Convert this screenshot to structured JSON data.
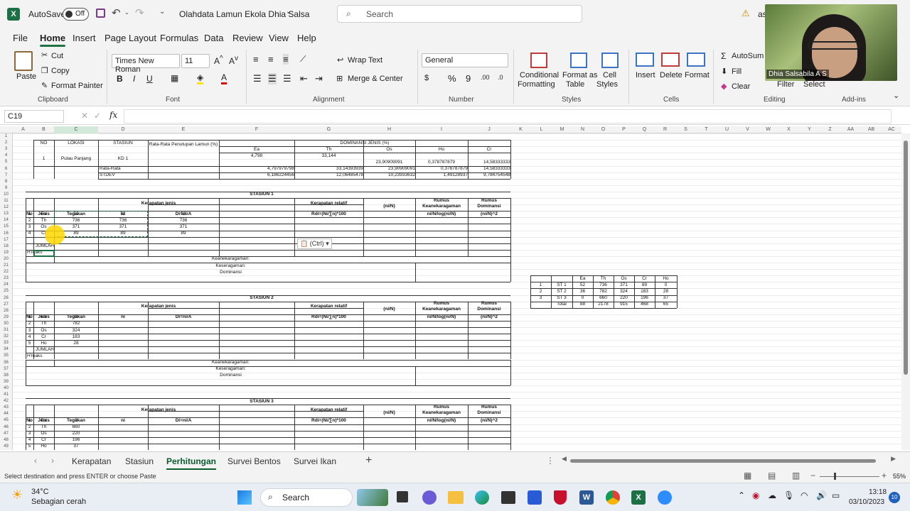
{
  "app": {
    "autosave": "AutoSave",
    "autosave_state": "Off",
    "title": "Olahdata Lamun Ekola Dhia Salsa",
    "search": "Search",
    "user_short": "as"
  },
  "menu": [
    "File",
    "Home",
    "Insert",
    "Page Layout",
    "Formulas",
    "Data",
    "Review",
    "View",
    "Help"
  ],
  "ribbon": {
    "paste": "Paste",
    "cut": "Cut",
    "copy": "Copy",
    "format_painter": "Format Painter",
    "clipboard": "Clipboard",
    "font_name": "Times New Roman",
    "font_size": "11",
    "font": "Font",
    "wrap_text": "Wrap Text",
    "merge_center": "Merge & Center",
    "alignment": "Alignment",
    "number_format": "General",
    "number": "Number",
    "cond_fmt_1": "Conditional",
    "cond_fmt_2": "Formatting",
    "fmt_table_1": "Format as",
    "fmt_table_2": "Table",
    "cell_styles_1": "Cell",
    "cell_styles_2": "Styles",
    "styles": "Styles",
    "insert": "Insert",
    "delete": "Delete",
    "format": "Format",
    "cells": "Cells",
    "autosum": "AutoSum",
    "fill": "Fill",
    "clear": "Clear",
    "filter": "Filter",
    "select": "Select",
    "editing": "Editing",
    "addins": "Add-ins",
    "bold": "B",
    "italic": "I",
    "underline": "U"
  },
  "video": {
    "name": "Dhia Salsabila A S"
  },
  "formula": {
    "namebox": "C19",
    "fx": "fx",
    "value": ""
  },
  "columns": [
    "A",
    "B",
    "C",
    "D",
    "E",
    "F",
    "G",
    "H",
    "I",
    "J",
    "K",
    "L",
    "M",
    "N",
    "O",
    "P",
    "Q",
    "R",
    "S",
    "T",
    "U",
    "V",
    "W",
    "X",
    "Y",
    "Z",
    "AA",
    "AB",
    "AC"
  ],
  "rows": [
    "1",
    "2",
    "3",
    "4",
    "5",
    "6",
    "7",
    "8",
    "9",
    "10",
    "11",
    "12",
    "13",
    "14",
    "15",
    "16",
    "17",
    "18",
    "19",
    "20",
    "21",
    "22",
    "23",
    "24",
    "25",
    "26",
    "27",
    "28",
    "29",
    "30",
    "31",
    "32",
    "33",
    "34",
    "35",
    "36",
    "37",
    "38",
    "39",
    "40",
    "41",
    "42",
    "43",
    "44",
    "45",
    "46",
    "47",
    "48",
    "49"
  ],
  "sheet": {
    "top": {
      "no": "NO",
      "lokasi": "LOKASI",
      "stasiun": "STASIUN",
      "rata": "Rata-Rata Penutupan Lamun (%)",
      "dominansi": "DOMINANSI JENIS (%)",
      "sp": [
        "Ea",
        "Th",
        "Os",
        "Ho",
        "Cr"
      ],
      "row_no": "1",
      "row_lokasi": "Pulau Panjang",
      "row_stasiun": "KD 1",
      "vals": [
        "4,798",
        "33,144",
        "23,90909091",
        "0,378787879",
        "14,58333333"
      ],
      "rata_label": "Rata-Rata",
      "rata_vals": [
        "4,797979798",
        "33,14393939",
        "23,90909091",
        "0,378787879",
        "14,58333333"
      ],
      "stdev_label": "STDEV",
      "stdev_vals": [
        "6,186224456",
        "12,06485478",
        "10,23933632",
        "1,49128937",
        "9,784754548"
      ]
    },
    "hdr": {
      "kerapatan_jenis": "Kerapatan jenis",
      "kerapatan_relatif": "Kerapatan relatif",
      "nin": "(ni/N)",
      "rumus_k1": "Rumus",
      "rumus_k2": "Keanekaragaman",
      "rumus_d1": "Rumus",
      "rumus_d2": "Dominansi",
      "no": "No",
      "jenis": "Jenis",
      "tegakan": "Tegakan",
      "ni": "ni",
      "di": "Di=ni/A",
      "rdi": "Rdi=(Ni/∑n)*100",
      "nilog": "ni/N/log(ni/N)",
      "nin2": "(ni/N)^2",
      "jumlah": "JUMLAH",
      "hmaks": "H'maks",
      "keanek": "Keanekaragaman:",
      "keser": "Keseragaman:",
      "domin": "Dominansi"
    },
    "s1": {
      "title": "STASIUN 1",
      "rows": [
        [
          "1",
          "Ea",
          "52",
          "52",
          "52"
        ],
        [
          "2",
          "Th",
          "736",
          "736",
          "736"
        ],
        [
          "3",
          "Os",
          "371",
          "371",
          "371"
        ],
        [
          "4",
          "Cr",
          "89",
          "89",
          "89"
        ]
      ]
    },
    "s2": {
      "title": "STASIUN 2",
      "rows": [
        [
          "1",
          "Ea",
          "36"
        ],
        [
          "2",
          "Th",
          "782"
        ],
        [
          "3",
          "Os",
          "324"
        ],
        [
          "4",
          "Cr",
          "183"
        ],
        [
          "5",
          "Ho",
          "28"
        ]
      ]
    },
    "s3": {
      "title": "STASIUN 3",
      "rows": [
        [
          "1",
          "Ea",
          "0"
        ],
        [
          "2",
          "Th",
          "660"
        ],
        [
          "3",
          "Os",
          "220"
        ],
        [
          "4",
          "Cr",
          "196"
        ],
        [
          "5",
          "Ho",
          "37"
        ]
      ]
    },
    "paste_ctrl": "(Ctrl)",
    "summary": {
      "cols": [
        "Ea",
        "Th",
        "Os",
        "Cr",
        "Ho"
      ],
      "rows": [
        [
          "1",
          "ST 1",
          "52",
          "736",
          "371",
          "89",
          "0"
        ],
        [
          "2",
          "ST 2",
          "36",
          "782",
          "324",
          "183",
          "28"
        ],
        [
          "3",
          "ST 3",
          "0",
          "660",
          "220",
          "196",
          "37"
        ]
      ],
      "total_label": "Total",
      "totals": [
        "88",
        "2178",
        "915",
        "468",
        "65"
      ]
    }
  },
  "tabs": [
    "Kerapatan",
    "Stasiun",
    "Perhitungan",
    "Survei Bentos",
    "Survei Ikan"
  ],
  "status": {
    "message": "Select destination and press ENTER or choose Paste",
    "zoom": "55%"
  },
  "taskbar": {
    "temp": "34°C",
    "weather": "Sebagian cerah",
    "search": "Search",
    "time": "13:18",
    "date": "03/10/2023",
    "badge": "10"
  }
}
